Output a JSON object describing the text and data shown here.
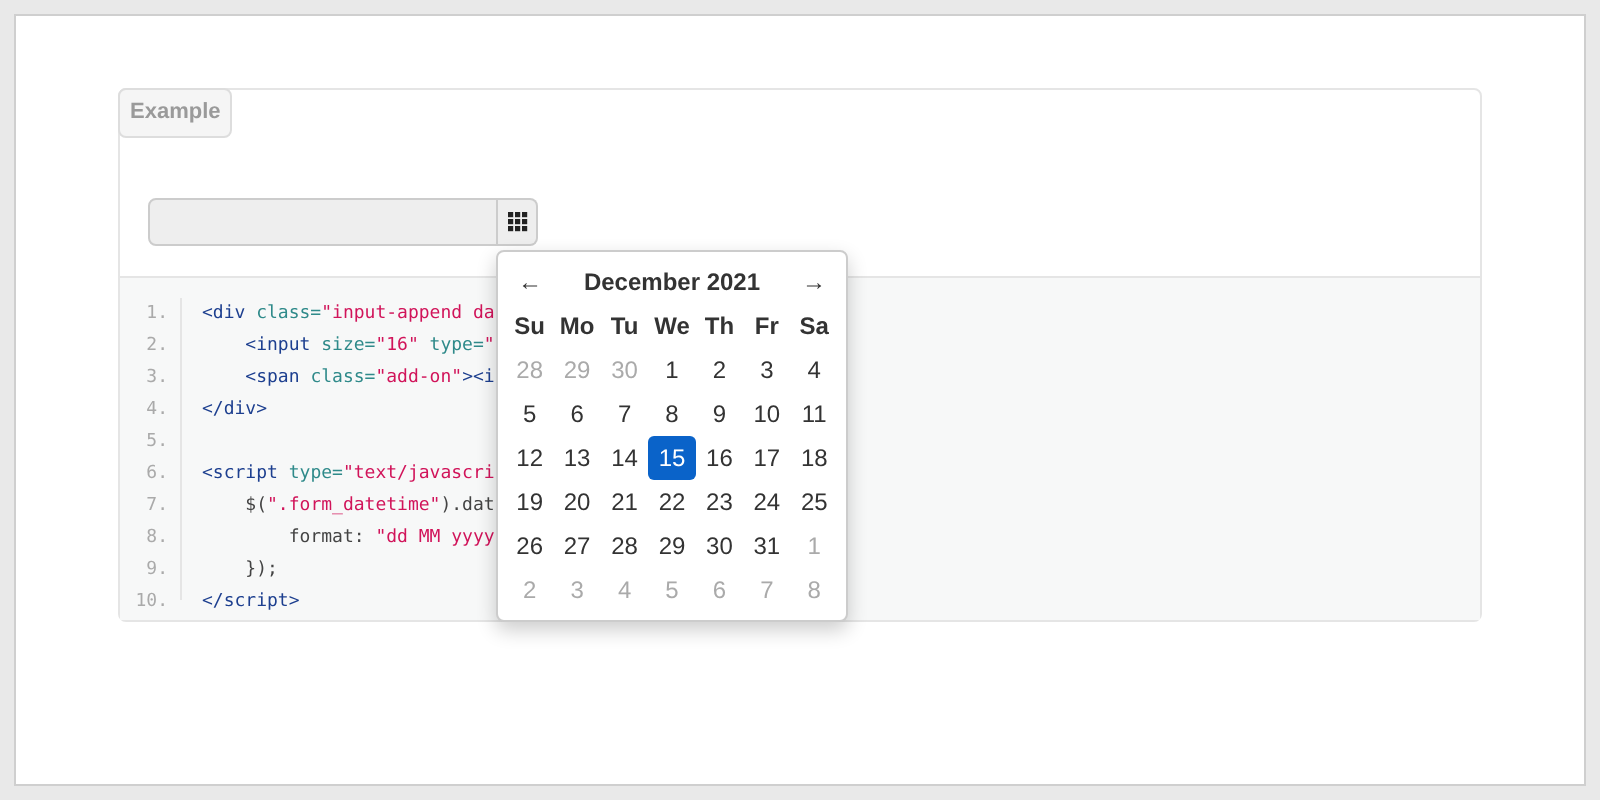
{
  "tab_label": "Example",
  "code_lines": [
    {
      "number": "1.",
      "tokens": [
        {
          "kind": "tag",
          "text": "<div "
        },
        {
          "kind": "attr",
          "text": "class="
        },
        {
          "kind": "str",
          "text": "\"input-append da"
        }
      ]
    },
    {
      "number": "2.",
      "tokens": [
        {
          "kind": "tag",
          "text": "    <input "
        },
        {
          "kind": "attr",
          "text": "size="
        },
        {
          "kind": "str",
          "text": "\"16\" "
        },
        {
          "kind": "attr",
          "text": "type="
        },
        {
          "kind": "str",
          "text": "\""
        }
      ]
    },
    {
      "number": "3.",
      "tokens": [
        {
          "kind": "tag",
          "text": "    <span "
        },
        {
          "kind": "attr",
          "text": "class="
        },
        {
          "kind": "str",
          "text": "\"add-on\""
        },
        {
          "kind": "tag",
          "text": "><i"
        }
      ]
    },
    {
      "number": "4.",
      "tokens": [
        {
          "kind": "tag",
          "text": "</div>"
        }
      ]
    },
    {
      "number": "5."
    },
    {
      "number": "6.",
      "tokens": [
        {
          "kind": "tag",
          "text": "<script "
        },
        {
          "kind": "attr",
          "text": "type="
        },
        {
          "kind": "str",
          "text": "\"text/javascri"
        }
      ]
    },
    {
      "number": "7.",
      "tokens": [
        {
          "kind": "plain",
          "text": "    $("
        },
        {
          "kind": "str",
          "text": "\".form_datetime\""
        },
        {
          "kind": "plain",
          "text": ").dat"
        }
      ]
    },
    {
      "number": "8.",
      "tokens": [
        {
          "kind": "plain",
          "text": "        format: "
        },
        {
          "kind": "str",
          "text": "\"dd MM yyyy"
        }
      ]
    },
    {
      "number": "9.",
      "tokens": [
        {
          "kind": "plain",
          "text": "    });"
        }
      ]
    },
    {
      "number": "10.",
      "tokens": [
        {
          "kind": "tag",
          "text": "</script>"
        }
      ]
    }
  ],
  "datepicker": {
    "prev": "←",
    "title": "December 2021",
    "next": "→",
    "weekdays": [
      "Su",
      "Mo",
      "Tu",
      "We",
      "Th",
      "Fr",
      "Sa"
    ],
    "weeks": [
      [
        {
          "day": "28",
          "muted": true,
          "selected": false
        },
        {
          "day": "29",
          "muted": true,
          "selected": false
        },
        {
          "day": "30",
          "muted": true,
          "selected": false
        },
        {
          "day": "1",
          "muted": false,
          "selected": false
        },
        {
          "day": "2",
          "muted": false,
          "selected": false
        },
        {
          "day": "3",
          "muted": false,
          "selected": false
        },
        {
          "day": "4",
          "muted": false,
          "selected": false
        }
      ],
      [
        {
          "day": "5",
          "muted": false,
          "selected": false
        },
        {
          "day": "6",
          "muted": false,
          "selected": false
        },
        {
          "day": "7",
          "muted": false,
          "selected": false
        },
        {
          "day": "8",
          "muted": false,
          "selected": false
        },
        {
          "day": "9",
          "muted": false,
          "selected": false
        },
        {
          "day": "10",
          "muted": false,
          "selected": false
        },
        {
          "day": "11",
          "muted": false,
          "selected": false
        }
      ],
      [
        {
          "day": "12",
          "muted": false,
          "selected": false
        },
        {
          "day": "13",
          "muted": false,
          "selected": false
        },
        {
          "day": "14",
          "muted": false,
          "selected": false
        },
        {
          "day": "15",
          "muted": false,
          "selected": true
        },
        {
          "day": "16",
          "muted": false,
          "selected": false
        },
        {
          "day": "17",
          "muted": false,
          "selected": false
        },
        {
          "day": "18",
          "muted": false,
          "selected": false
        }
      ],
      [
        {
          "day": "19",
          "muted": false,
          "selected": false
        },
        {
          "day": "20",
          "muted": false,
          "selected": false
        },
        {
          "day": "21",
          "muted": false,
          "selected": false
        },
        {
          "day": "22",
          "muted": false,
          "selected": false
        },
        {
          "day": "23",
          "muted": false,
          "selected": false
        },
        {
          "day": "24",
          "muted": false,
          "selected": false
        },
        {
          "day": "25",
          "muted": false,
          "selected": false
        }
      ],
      [
        {
          "day": "26",
          "muted": false,
          "selected": false
        },
        {
          "day": "27",
          "muted": false,
          "selected": false
        },
        {
          "day": "28",
          "muted": false,
          "selected": false
        },
        {
          "day": "29",
          "muted": false,
          "selected": false
        },
        {
          "day": "30",
          "muted": false,
          "selected": false
        },
        {
          "day": "31",
          "muted": false,
          "selected": false
        },
        {
          "day": "1",
          "muted": true,
          "selected": false
        }
      ],
      [
        {
          "day": "2",
          "muted": true,
          "selected": false
        },
        {
          "day": "3",
          "muted": true,
          "selected": false
        },
        {
          "day": "4",
          "muted": true,
          "selected": false
        },
        {
          "day": "5",
          "muted": true,
          "selected": false
        },
        {
          "day": "6",
          "muted": true,
          "selected": false
        },
        {
          "day": "7",
          "muted": true,
          "selected": false
        },
        {
          "day": "8",
          "muted": true,
          "selected": false
        }
      ]
    ]
  }
}
